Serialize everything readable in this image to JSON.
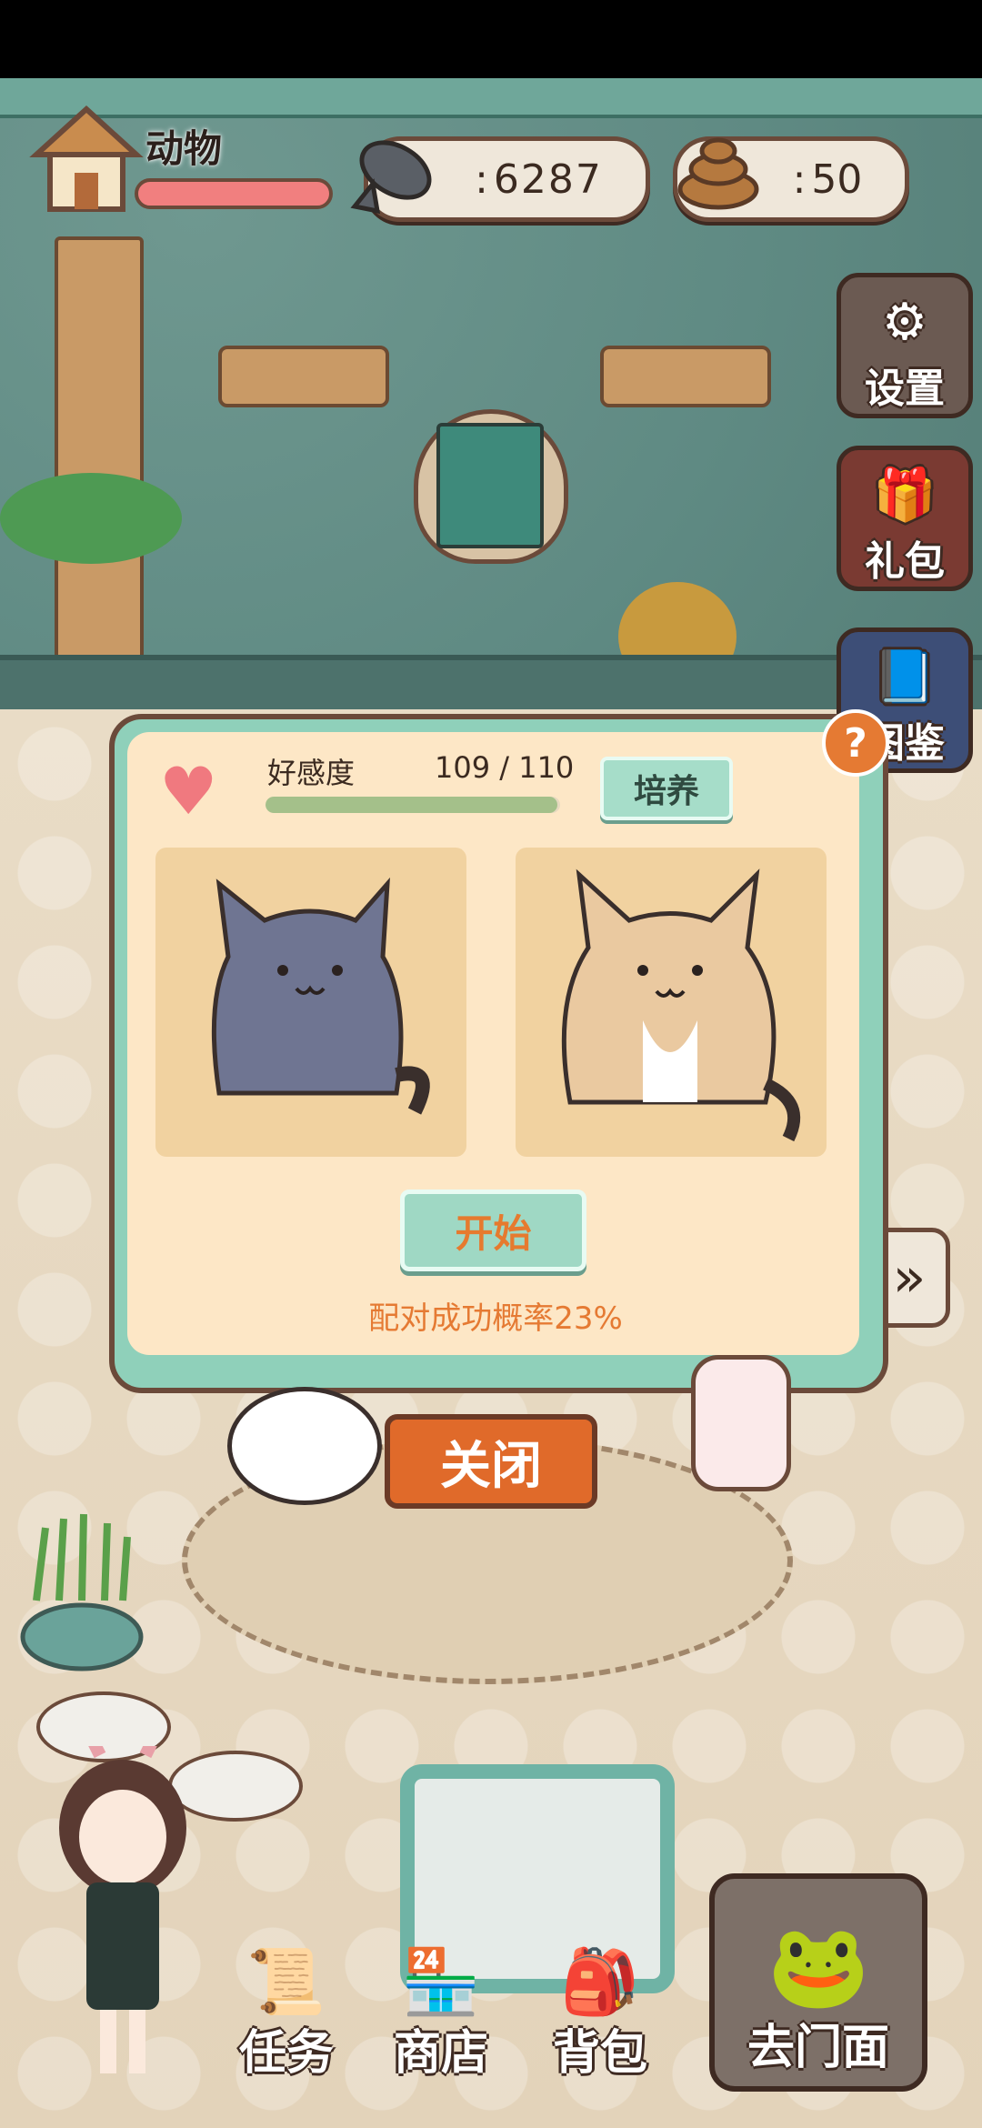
{
  "hud": {
    "animal_label": "动物",
    "animal_bar_level": 1.0,
    "fish_count": "6287",
    "poop_count": "50",
    "fish_prefix": ":",
    "poop_prefix": ":"
  },
  "side_buttons": [
    {
      "label": "设置",
      "icon": "gear-icon"
    },
    {
      "label": "礼包",
      "icon": "gift-icon"
    },
    {
      "label": "图鉴",
      "icon": "book-icon"
    }
  ],
  "dialog": {
    "help": "?",
    "affinity_label": "好感度",
    "affinity_value": "109 / 110",
    "affinity_fraction": 0.9909,
    "train_label": "培养",
    "start_label": "开始",
    "pair_rate_text": "配对成功概率23%",
    "close_label": "关闭",
    "cats": [
      "gray-cat",
      "tan-fluffy-cat"
    ]
  },
  "bottom_bar": {
    "task_label": "任务",
    "shop_label": "商店",
    "bag_label": "背包",
    "store_label": "去门面"
  },
  "colors": {
    "accent_orange": "#e57a33",
    "dialog_mint": "#8fd0ba",
    "heart_pink": "#f0797f"
  }
}
